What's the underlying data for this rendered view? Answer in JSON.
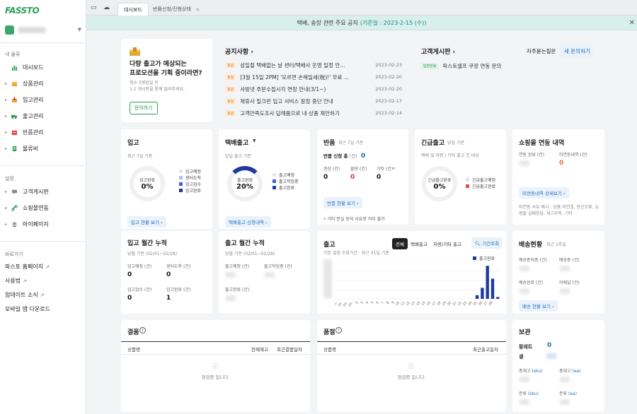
{
  "brand": {
    "logo": "FASSTO"
  },
  "sidebar": {
    "section_my": "내 물류",
    "items": [
      {
        "label": "대시보드",
        "icon": "bar-chart-icon",
        "arrow": ""
      },
      {
        "label": "상품관리",
        "icon": "box-icon",
        "arrow": "▸"
      },
      {
        "label": "입고관리",
        "icon": "inbound-icon",
        "arrow": "▸"
      },
      {
        "label": "출고관리",
        "icon": "truck-icon",
        "arrow": "▸"
      },
      {
        "label": "반품관리",
        "icon": "return-icon",
        "arrow": "▸"
      },
      {
        "label": "물류비",
        "icon": "receipt-icon",
        "arrow": "▸"
      }
    ],
    "section_settings": "설정",
    "settings": [
      {
        "label": "고객게시판",
        "icon": "chat-icon",
        "arrow": "▸"
      },
      {
        "label": "쇼핑몰연동",
        "icon": "link-icon",
        "arrow": "▸"
      },
      {
        "label": "마이페이지",
        "icon": "user-icon",
        "arrow": "▸"
      }
    ],
    "section_shortcuts": "바로가기",
    "shortcuts": [
      {
        "label": "파스토 홈페이지",
        "ext": "↗"
      },
      {
        "label": "사용법",
        "ext": "↗"
      },
      {
        "label": "업데이트 소식",
        "ext": "↗"
      },
      {
        "label": "모바일 앱 다운로드",
        "ext": ""
      }
    ]
  },
  "tabs": [
    {
      "label": "대시보드"
    },
    {
      "label": "반품신청/진행상태",
      "close": "×"
    }
  ],
  "notice": {
    "text": "택배, 송장 관련 주요 공지",
    "highlight": "(기준일 : 2023-2-15 (수))",
    "close": "✕"
  },
  "promo": {
    "title1": "다량 출고가 예상되는",
    "title2": "프로모션을 기획 중이라면?",
    "desc1": "최소 5영업일 전",
    "desc2": "1:1 게시판을 통해 알려주세요.",
    "button": "문의하기"
  },
  "notices": {
    "title": "공지사항 ›",
    "items": [
      {
        "badge": "점검",
        "text": "삼일절 택배없는 날 센터/택배사 운영 일정 안...",
        "date": "2023-02-23"
      },
      {
        "badge": "점검",
        "text": "[3월 15일 2PM] '모르면 손해일세(稅)!' 무료 ...",
        "date": "2023-02-20"
      },
      {
        "badge": "점검",
        "text": "사방넷 주문수집시각 연장 안내(3/1~)",
        "date": "2023-02-20"
      },
      {
        "badge": "점검",
        "text": "제휴사 밀크런 입고 서비스 잠정 중단 안내",
        "date": "2023-02-17"
      },
      {
        "badge": "점검",
        "text": "고객만족도조사 답례품으로 내 상품 제안하기",
        "date": "2023-02-14"
      }
    ]
  },
  "board": {
    "title": "고객게시판 ›",
    "badge": "답변완료",
    "item": "파스토셀프 쿠팡 연동 문의"
  },
  "faq": {
    "label": "자주묻는질문",
    "button": "새 문의하기"
  },
  "inbound": {
    "title": "입고",
    "sub": "최근 7일 기준",
    "donut_label": "입고완료",
    "donut_value": "0%",
    "legend": [
      {
        "label": "입고예정",
        "color": "#dde6f5"
      },
      {
        "label": "센터도착",
        "color": "#a9c1ec"
      },
      {
        "label": "입고검수",
        "color": "#3b63d6"
      },
      {
        "label": "입고완료",
        "color": "#1f3a9e"
      }
    ],
    "button": "입고 현황 보기 ›"
  },
  "parcel": {
    "title": "택배출고",
    "caret": "▼",
    "sub": "당일 출고 기준",
    "donut_label": "출고완료",
    "donut_value": "20%",
    "legend": [
      {
        "label": "출고예정",
        "color": "#dde6f5"
      },
      {
        "label": "출고작업중",
        "color": "#3b63d6"
      },
      {
        "label": "출고완료",
        "color": "#1f3a9e"
      }
    ],
    "button": "택배출고 신청내역 ›"
  },
  "returns": {
    "title": "반품",
    "title_sub": "최근 7일 기준",
    "req_label": "반품 신청 총",
    "unit": "(건)",
    "req_value": "0",
    "cols": [
      {
        "label": "정상",
        "unit": "(건)",
        "value": "0",
        "color": "#111"
      },
      {
        "label": "불량",
        "unit": "(건)",
        "value": "0",
        "color": "#d9342b"
      },
      {
        "label": "기타",
        "unit": "(건)",
        "value": "0",
        "color": "#111"
      }
    ],
    "button": "반품 현황 보기 ›",
    "note": "기타 분실 등의 사유로 처리 불가"
  },
  "urgent": {
    "title": "긴급출고",
    "title_sub": "당일 기준",
    "sub": "택배 및 차량 / 기타 출고 건 대상",
    "donut_label": "긴급출고완료",
    "donut_value": "0%",
    "legend": [
      {
        "label": "긴급출고예정",
        "color": "#e4e4e4"
      },
      {
        "label": "긴급출고완료",
        "color": "#e8484a"
      }
    ]
  },
  "shopsync": {
    "title": "쇼핑몰 연동 내역",
    "done_label": "연동 완료",
    "done_unit": "(건)",
    "err_label": "미연동내역",
    "err_unit": "(건)",
    "err_value": "0",
    "button": "미연동내역 상세보기 ›",
    "note": "미연동 사유 예시 : 상품 미연결, 동신오류, 쇼핑몰 실패응답, 재고부족, 기타"
  },
  "inbound_monthly": {
    "title": "입고 월간 누적",
    "sub": "당월 기준 (02/01~02/28)",
    "cells": [
      {
        "label": "입고예정",
        "unit": "(건)",
        "value": "0"
      },
      {
        "label": "센터도착",
        "unit": "(건)",
        "value": "0"
      },
      {
        "label": "입고검수",
        "unit": "(건)",
        "value": "0"
      },
      {
        "label": "입고완료",
        "unit": "(건)",
        "value": "1"
      }
    ]
  },
  "outbound_monthly": {
    "title": "출고 월간 누적",
    "sub": "당월 기준 (02/01~02/28)",
    "cells": [
      {
        "label": "출고예정",
        "unit": "(건)"
      },
      {
        "label": "출고작업중",
        "unit": "(건)"
      },
      {
        "label": "출고완료",
        "unit": "(건)"
      }
    ]
  },
  "outbound": {
    "title": "출고",
    "sub": "기본 설정 조회기간 : 최근 31일 기준",
    "segments": [
      "전체",
      "택배출고",
      "차량/기타 출고"
    ],
    "period_btn": "기간조회",
    "legend": "출고완료"
  },
  "chart_data": {
    "type": "bar",
    "series": [
      {
        "name": "출고완료",
        "values": [
          0,
          0,
          0,
          0,
          0,
          0,
          0,
          0,
          0,
          0,
          0,
          0,
          0,
          0,
          0,
          0,
          0,
          0,
          0,
          0,
          0,
          0,
          0,
          0,
          0,
          0,
          0,
          2,
          6,
          18,
          11,
          1
        ]
      }
    ],
    "categories": [
      "01-28",
      "01-29",
      "01-30",
      "01-31",
      "02-01",
      "02-02",
      "02-03",
      "02-04",
      "02-05",
      "02-06",
      "02-07",
      "02-08",
      "02-09",
      "02-10",
      "02-11",
      "02-12",
      "02-13",
      "02-14",
      "02-15",
      "02-16",
      "02-17",
      "02-18",
      "02-19",
      "02-20",
      "02-21",
      "02-22",
      "02-23",
      "02-24",
      "02-25",
      "02-26",
      "02-27",
      "02-28"
    ],
    "ticks": [
      "01-",
      "01-",
      "01-",
      "01-",
      "2",
      "3",
      "4",
      "5",
      "6",
      "7",
      "8",
      "9",
      "10",
      "11",
      "12",
      "13",
      "14",
      "15",
      "16",
      "17",
      "18",
      "19",
      "20",
      "21",
      "22",
      "23",
      "24",
      "25",
      "26",
      "27",
      "28",
      ""
    ],
    "ylim": [
      0,
      20
    ],
    "grid": true,
    "legend_position": "top-right"
  },
  "delivery": {
    "title": "배송현황",
    "sub": "최근 1주일",
    "cells": [
      {
        "label": "배송준비중",
        "unit": "(건)"
      },
      {
        "label": "배송중",
        "unit": "(건)"
      },
      {
        "label": "배송완료",
        "unit": "(건)"
      },
      {
        "label": "미배달",
        "unit": "(건)"
      }
    ],
    "button": "배송 현황 보기 ›"
  },
  "shortage": {
    "title": "결품",
    "info": "i",
    "col1": "상품명",
    "col2": "현재재고",
    "col3": "최근결품일자",
    "empty": "점검중 입니다."
  },
  "soldout": {
    "title": "품절",
    "info": "i",
    "col1": "상품명",
    "col2": "최근출고일자",
    "empty": "점검중 입니다."
  },
  "storage": {
    "title": "보관",
    "pallet": "팔레트",
    "cell": "셀",
    "pallet_value": "0",
    "rows": [
      {
        "label": "총재고",
        "unit": "(sku)"
      },
      {
        "label": "총재고",
        "unit": "(ea)"
      },
      {
        "label": "분류",
        "unit": "(sku)"
      },
      {
        "label": "분류",
        "unit": "(ea)"
      }
    ]
  }
}
